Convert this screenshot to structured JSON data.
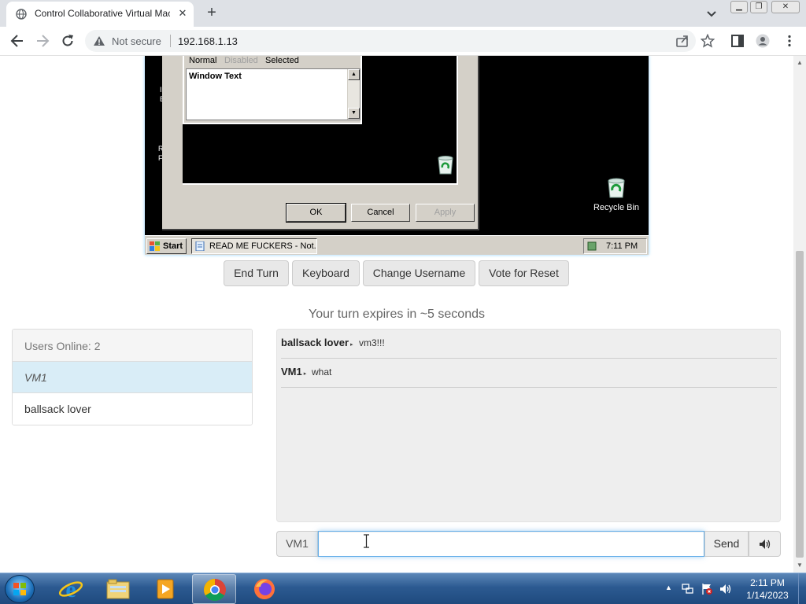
{
  "browser": {
    "tab_title": "Control Collaborative Virtual Mac",
    "tab_close": "✕",
    "new_tab": "+",
    "security_label": "Not secure",
    "url": "192.168.1.13",
    "window_controls": {
      "minimize": "▁",
      "maximize": "❐",
      "close": "✕"
    },
    "icons": [
      "globe-icon",
      "back-icon",
      "forward-icon",
      "reload-icon",
      "warning-icon",
      "share-icon",
      "star-icon",
      "side-panel-icon",
      "profile-icon",
      "menu-icon"
    ]
  },
  "vm": {
    "appearance_states": {
      "normal": "Normal",
      "disabled": "Disabled",
      "selected": "Selected"
    },
    "window_text_sample": "Window Text",
    "buttons": {
      "ok": "OK",
      "cancel": "Cancel",
      "apply": "Apply"
    },
    "desktop_fragments": [
      "I",
      "E",
      "R",
      "F"
    ],
    "recycle_bin_label": "Recycle Bin",
    "taskbar": {
      "start_label": "Start",
      "task_label": "READ ME FUCKERS - Not...",
      "clock": "7:11 PM"
    }
  },
  "controls": {
    "end_turn": "End Turn",
    "keyboard": "Keyboard",
    "change_username": "Change Username",
    "vote_reset": "Vote for Reset"
  },
  "turn_status": "Your turn expires in ~5 seconds",
  "users": {
    "header": "Users Online: 2",
    "list": [
      "VM1",
      "ballsack lover"
    ]
  },
  "chat": {
    "messages": [
      {
        "user": "ballsack lover",
        "text": "vm3!!!"
      },
      {
        "user": "VM1",
        "text": "what"
      }
    ],
    "arrow": "▸",
    "username_addon": "VM1",
    "input_value": "",
    "send_label": "Send"
  },
  "taskbar": {
    "apps": [
      "internet-explorer",
      "windows-explorer",
      "media-player",
      "chrome",
      "firefox"
    ],
    "tray_arrow": "▲",
    "time": "2:11 PM",
    "date": "1/14/2023"
  },
  "colors": {
    "active_user_bg": "#d9edf7",
    "chat_panel_bg": "#eeeeee",
    "input_focus_border": "#66afe9",
    "vm_dialog_face": "#d4d0c8",
    "win_taskbar": "#2c5a91"
  }
}
